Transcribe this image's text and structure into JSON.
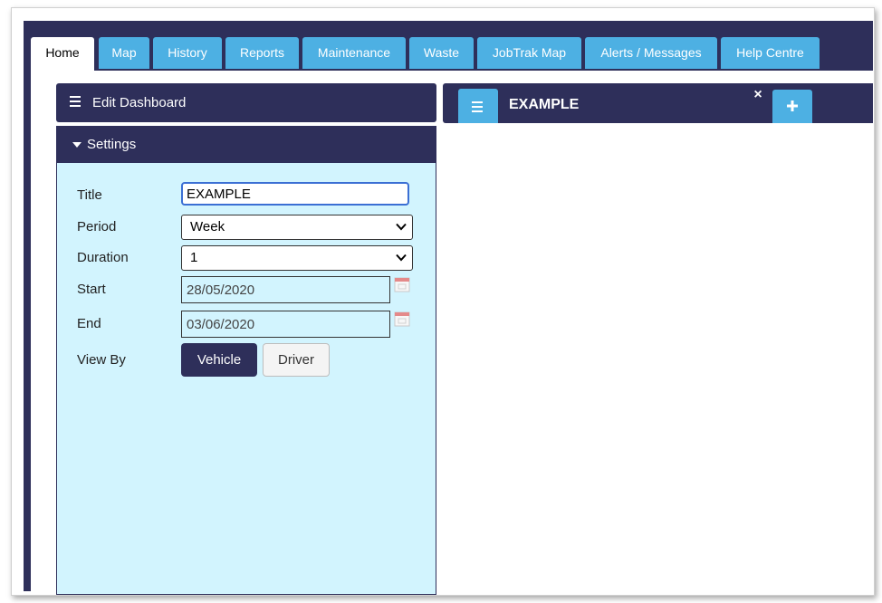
{
  "nav": {
    "tabs": [
      {
        "label": "Home",
        "active": true
      },
      {
        "label": "Map"
      },
      {
        "label": "History"
      },
      {
        "label": "Reports"
      },
      {
        "label": "Maintenance"
      },
      {
        "label": "Waste"
      },
      {
        "label": "JobTrak Map"
      },
      {
        "label": "Alerts / Messages"
      },
      {
        "label": "Help Centre"
      }
    ]
  },
  "edit_dashboard": {
    "label": "Edit Dashboard",
    "icon": "menu-icon"
  },
  "settings": {
    "header": "Settings",
    "title": {
      "label": "Title",
      "value": "EXAMPLE"
    },
    "period": {
      "label": "Period",
      "value": "Week"
    },
    "duration": {
      "label": "Duration",
      "value": "1"
    },
    "start": {
      "label": "Start",
      "value": "28/05/2020",
      "icon": "calendar-icon"
    },
    "end": {
      "label": "End",
      "value": "03/06/2020",
      "icon": "calendar-icon"
    },
    "view_by": {
      "label": "View By",
      "options": [
        "Vehicle",
        "Driver"
      ],
      "selected": "Vehicle"
    }
  },
  "dashboard": {
    "title": "EXAMPLE",
    "close_glyph": "×",
    "menu_icon": "hamburger-icon",
    "add_icon": "plus-icon"
  },
  "colors": {
    "navy": "#2e2f5a",
    "tab_blue": "#4db0e3",
    "panel_bg": "#d2f4fe",
    "focus_border": "#3b6fd4"
  }
}
